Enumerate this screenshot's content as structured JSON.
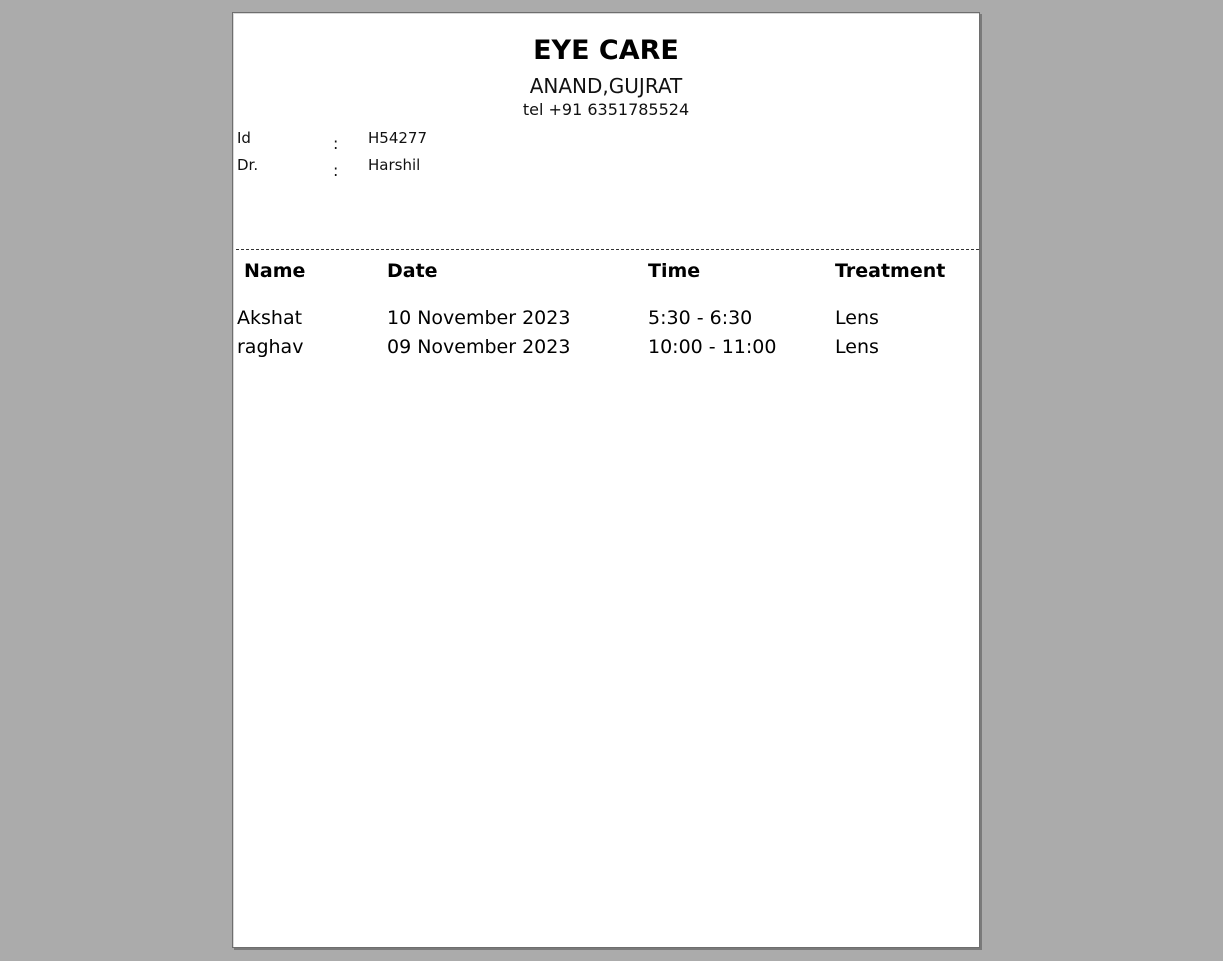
{
  "header": {
    "title": "EYE CARE",
    "location": "ANAND,GUJRAT",
    "telephone": "tel +91 6351785524"
  },
  "info": {
    "id_label": "Id",
    "id_value": "H54277",
    "doctor_label": "Dr.",
    "doctor_value": "Harshil",
    "separator": ":"
  },
  "table": {
    "columns": [
      "Name",
      "Date",
      "Time",
      "Treatment"
    ],
    "rows": [
      [
        "Akshat",
        "10 November 2023",
        "5:30 - 6:30",
        "Lens"
      ],
      [
        "raghav",
        "09 November 2023",
        "10:00 - 11:00",
        "Lens"
      ]
    ]
  }
}
